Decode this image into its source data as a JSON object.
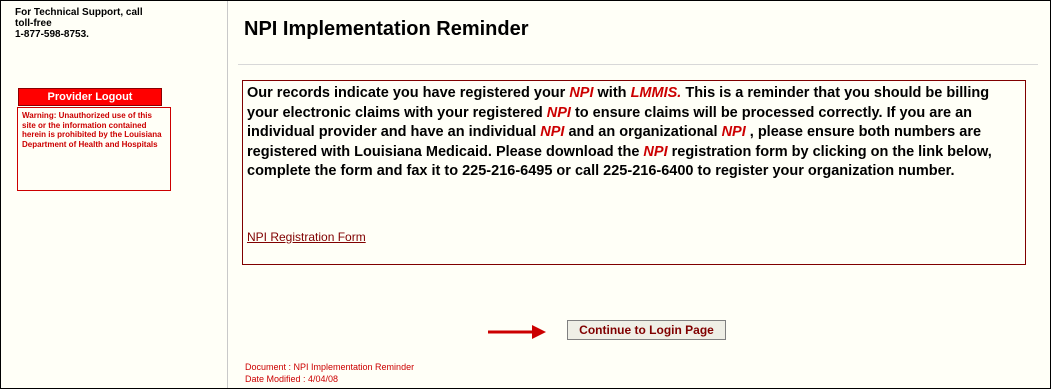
{
  "sidebar": {
    "support_line1": "For Technical Support, call",
    "support_line2": "toll-free",
    "support_line3": "1-877-598-8753.",
    "logout_label": "Provider Logout",
    "warning_text": "Warning: Unauthorized use of this site or the information contained herein is prohibited by the Louisiana Department of Health and Hospitals"
  },
  "main": {
    "title": "NPI Implementation Reminder",
    "message": {
      "p1": "Our records indicate you have registered your ",
      "npi": "NPI",
      "p2": " with ",
      "lmmis": "LMMIS.",
      "p3": " This is a reminder that you should be billing your electronic claims with your registered ",
      "p4": " to ensure claims will be processed correctly. If you are an individual provider and have an individual ",
      "p5": " and an organizational ",
      "p6": " , please ensure both numbers are registered with Louisiana Medicaid. Please download the ",
      "p7": " registration form by clicking on the link below, complete the form and fax it to 225-216-6495 or call 225-216-6400 to register your organization number."
    },
    "link_label": "NPI Registration Form",
    "continue_label": "Continue to Login Page",
    "footer_document": "Document : NPI Implementation Reminder",
    "footer_date": "Date Modified : 4/04/08"
  },
  "colors": {
    "accent_red": "#cc0000",
    "maroon": "#800000",
    "page_bg": "#fffff7"
  },
  "icons": {
    "arrow": "arrow-right-icon"
  }
}
